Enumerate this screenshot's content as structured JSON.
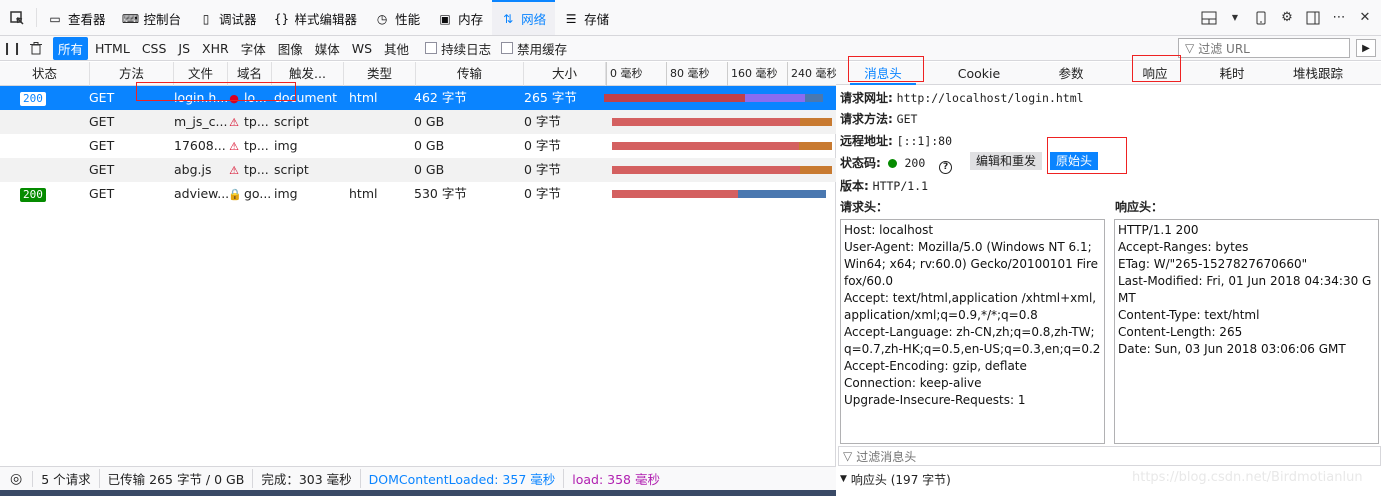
{
  "toolbar": {
    "tabs": [
      {
        "label": "查看器",
        "icon": "inspector-icon"
      },
      {
        "label": "控制台",
        "icon": "console-icon"
      },
      {
        "label": "调试器",
        "icon": "debugger-icon"
      },
      {
        "label": "样式编辑器",
        "icon": "style-editor-icon"
      },
      {
        "label": "性能",
        "icon": "performance-icon"
      },
      {
        "label": "内存",
        "icon": "memory-icon"
      },
      {
        "label": "网络",
        "icon": "network-icon"
      },
      {
        "label": "存储",
        "icon": "storage-icon"
      }
    ],
    "active_tab": "网络"
  },
  "filterbar": {
    "types": [
      "所有",
      "HTML",
      "CSS",
      "JS",
      "XHR",
      "字体",
      "图像",
      "媒体",
      "WS",
      "其他"
    ],
    "active_type": "所有",
    "persist_logs": "持续日志",
    "disable_cache": "禁用缓存",
    "filter_url_placeholder": "过滤 URL"
  },
  "table": {
    "headers": {
      "status": "状态",
      "method": "方法",
      "file": "文件",
      "domain": "域名",
      "cause": "触发...",
      "type": "类型",
      "transferred": "传输",
      "size": "大小"
    },
    "ticks": [
      "0 毫秒",
      "80 毫秒",
      "160 毫秒",
      "240 毫秒"
    ],
    "rows": [
      {
        "status": "200",
        "method": "GET",
        "file": "login.h...",
        "domain": "lo...",
        "cause": "document",
        "type": "html",
        "transferred": "462 字节",
        "size": "265 字节",
        "secure": false,
        "selected": true,
        "timing": [
          {
            "start": 0,
            "end": 186,
            "color": "#c0404a"
          },
          {
            "start": 186,
            "end": 264,
            "color": "#8a6cf0"
          },
          {
            "start": 264,
            "end": 288,
            "color": "#4a78b0"
          }
        ]
      },
      {
        "status": "",
        "method": "GET",
        "file": "m_js_c...",
        "domain": "tp...",
        "cause": "script",
        "type": "",
        "transferred": "0 GB",
        "size": "0 字节",
        "secure": false,
        "selected": false,
        "timing": [
          {
            "start": 10,
            "end": 258,
            "color": "#d46060"
          },
          {
            "start": 258,
            "end": 300,
            "color": "#c87a30"
          }
        ]
      },
      {
        "status": "",
        "method": "GET",
        "file": "17608...",
        "domain": "tp...",
        "cause": "img",
        "type": "",
        "transferred": "0 GB",
        "size": "0 字节",
        "secure": false,
        "selected": false,
        "timing": [
          {
            "start": 10,
            "end": 256,
            "color": "#d46060"
          },
          {
            "start": 256,
            "end": 300,
            "color": "#c87a30"
          }
        ]
      },
      {
        "status": "",
        "method": "GET",
        "file": "abg.js",
        "domain": "tp...",
        "cause": "script",
        "type": "",
        "transferred": "0 GB",
        "size": "0 字节",
        "secure": false,
        "selected": false,
        "timing": [
          {
            "start": 10,
            "end": 258,
            "color": "#d46060"
          },
          {
            "start": 258,
            "end": 300,
            "color": "#c87a30"
          }
        ]
      },
      {
        "status": "200",
        "method": "GET",
        "file": "adview...",
        "domain": "go...",
        "cause": "img",
        "type": "html",
        "transferred": "530 字节",
        "size": "0 字节",
        "secure": true,
        "selected": false,
        "timing": [
          {
            "start": 10,
            "end": 176,
            "color": "#d46060"
          },
          {
            "start": 176,
            "end": 292,
            "color": "#4a78b0"
          }
        ]
      }
    ]
  },
  "statusbar": {
    "requests": "5 个请求",
    "transferred": "已传输 265 字节 / 0 GB",
    "finish": "完成：303 毫秒",
    "dom_content_loaded": "DOMContentLoaded: 357 毫秒",
    "load": "load: 358 毫秒"
  },
  "details": {
    "tabs": [
      "消息头",
      "Cookie",
      "参数",
      "响应",
      "耗时",
      "堆栈跟踪"
    ],
    "active_tab": "消息头",
    "request_url_label": "请求网址:",
    "request_url": "http://localhost/login.html",
    "request_method_label": "请求方法:",
    "request_method": "GET",
    "remote_addr_label": "远程地址:",
    "remote_addr": "[::1]:80",
    "status_label": "状态码:",
    "status_code": "200",
    "edit_resend": "编辑和重发",
    "raw_headers": "原始头",
    "version_label": "版本:",
    "version": "HTTP/1.1",
    "request_headers_title": "请求头：",
    "response_headers_title": "响应头：",
    "request_headers": [
      "Host: localhost",
      "User-Agent: Mozilla/5.0 (Windows NT 6.1; Win64; x64; rv:60.0) Gecko/20100101 Firefox/60.0",
      "Accept: text/html,application /xhtml+xml,application/xml;q=0.9,*/*;q=0.8",
      "Accept-Language: zh-CN,zh;q=0.8,zh-TW;q=0.7,zh-HK;q=0.5,en-US;q=0.3,en;q=0.2",
      "Accept-Encoding: gzip, deflate",
      "Connection: keep-alive",
      "Upgrade-Insecure-Requests: 1"
    ],
    "response_headers": [
      "HTTP/1.1 200",
      "Accept-Ranges: bytes",
      "ETag: W/\"265-1527827670660\"",
      "Last-Modified: Fri, 01 Jun 2018 04:34:30 GMT",
      "Content-Type: text/html",
      "Content-Length: 265",
      "Date: Sun, 03 Jun 2018 03:06:06 GMT"
    ],
    "filter_headers_placeholder": "过滤消息头",
    "response_header_summary": "响应头 (197 字节)"
  },
  "watermark": "https://blog.csdn.net/Birdmotianlun"
}
